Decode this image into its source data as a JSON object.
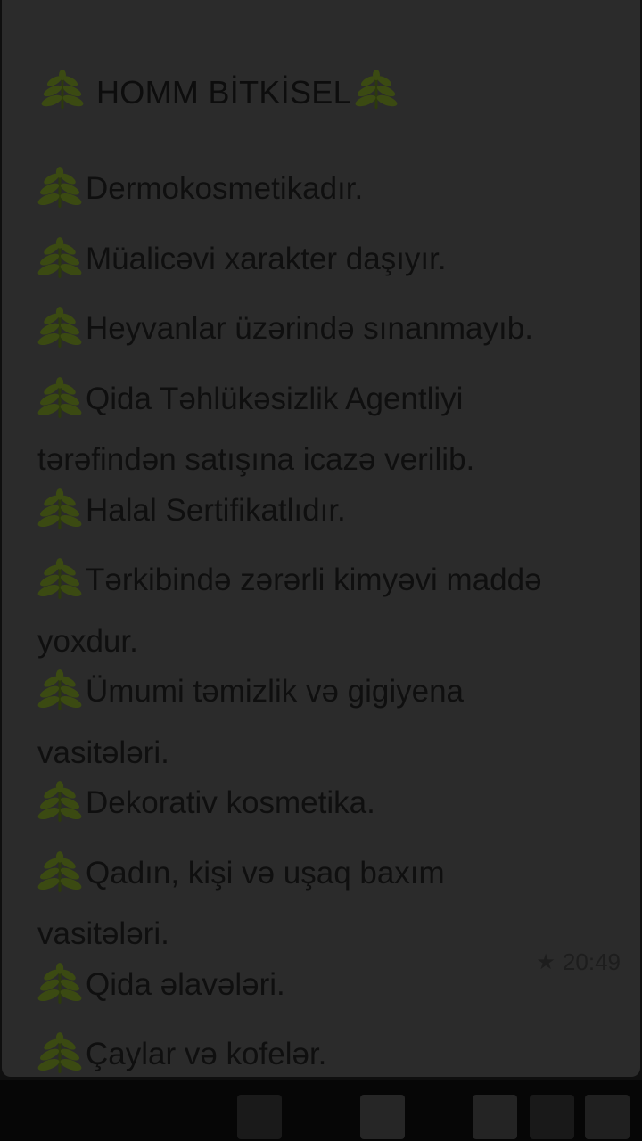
{
  "message": {
    "title": "HOMM BİTKİSEL",
    "lines": [
      "Dermokosmetikadır.",
      "Müalicəvi xarakter daşıyır.",
      "Heyvanlar üzərində sınanmayıb.",
      "Qida Təhlükəsizlik Agentliyi",
      "tərəfindən satışına icazə verilib.",
      "Halal Sertifikatlıdır.",
      "Tərkibində zərərli kimyəvi maddə",
      "yoxdur.",
      "Ümumi təmizlik və gigiyena",
      "vasitələri.",
      "Dekorativ kosmetika.",
      "Qadın, kişi və uşaq baxım",
      "vasitələri.",
      "Qida əlavələri.",
      "Çaylar və kofelər."
    ],
    "time": "20:49",
    "starred_icon": "star-icon",
    "bullet_icon": "herb-leaf-icon"
  },
  "colors": {
    "bubble": "#2b2b2b",
    "leaf": "#3b4a12"
  }
}
